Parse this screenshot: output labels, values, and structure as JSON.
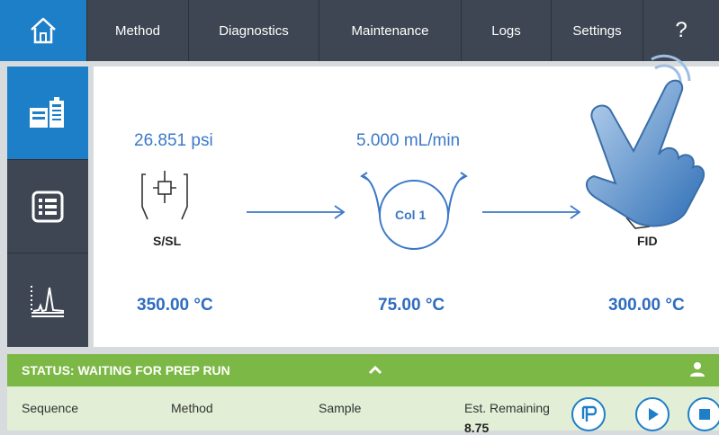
{
  "nav": {
    "home_icon": "home-icon",
    "tabs": [
      "Method",
      "Diagnostics",
      "Maintenance",
      "Logs",
      "Settings"
    ],
    "help_label": "?"
  },
  "sidebar": {
    "items": [
      {
        "icon": "instrument-status-icon",
        "active": true
      },
      {
        "icon": "list-icon",
        "active": false
      },
      {
        "icon": "chromatogram-icon",
        "active": false
      }
    ]
  },
  "flow": {
    "inlet": {
      "pressure": "26.851 psi",
      "label": "S/SL",
      "temperature": "350.00 °C"
    },
    "column": {
      "flow": "5.000 mL/min",
      "label": "Col 1",
      "temperature": "75.00 °C"
    },
    "detector": {
      "label": "FID",
      "temperature": "300.00 °C"
    }
  },
  "status": {
    "text": "STATUS: WAITING FOR PREP RUN",
    "chevron_icon": "chevron-up-icon",
    "user_icon": "user-icon"
  },
  "info": {
    "sequence_label": "Sequence",
    "method_label": "Method",
    "sample_label": "Sample",
    "remaining_label": "Est. Remaining",
    "remaining_value": "8.75"
  },
  "controls": {
    "prep_icon": "prep-run-icon",
    "start_icon": "play-icon",
    "stop_icon": "stop-icon"
  },
  "colors": {
    "accent_blue": "#1e7fc9",
    "nav_dark": "#3d4652",
    "status_green": "#7cb845",
    "info_green": "#e2efd6",
    "value_blue": "#3c78c8"
  }
}
